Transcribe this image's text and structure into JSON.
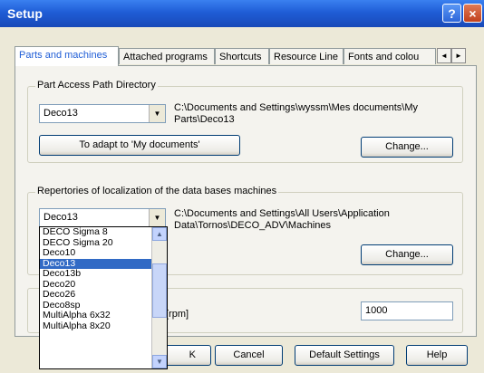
{
  "window": {
    "title": "Setup",
    "help": "?",
    "close": "×"
  },
  "tabs": [
    "Parts and machines",
    "Attached programs",
    "Shortcuts",
    "Resource Line",
    "Fonts and colou"
  ],
  "tab_scroll": {
    "left": "◄",
    "right": "►"
  },
  "part_access": {
    "title": "Part Access Path Directory",
    "combo_value": "Deco13",
    "path": "C:\\Documents and Settings\\wyssm\\Mes documents\\My Parts\\Deco13",
    "adapt_button": "To adapt to 'My documents'",
    "change_button": "Change..."
  },
  "repertories": {
    "title": "Repertories of localization of the data bases machines",
    "combo_value": "Deco13",
    "path": "C:\\Documents and Settings\\All Users\\Application Data\\Tornos\\DECO_ADV\\Machines",
    "change_button": "Change..."
  },
  "dropdown": {
    "items": [
      "DECO Sigma 8",
      "DECO Sigma 20",
      "Deco10",
      "Deco13",
      "Deco13b",
      "Deco20",
      "Deco26",
      "Deco8sp",
      "MultiAlpha 6x32",
      "MultiAlpha 8x20"
    ],
    "selected_index": 3,
    "scroll_up": "▲",
    "scroll_down": "▼"
  },
  "speed": {
    "unit_label": "[rpm]",
    "value": "1000"
  },
  "footer": {
    "ok_fragment": "K",
    "cancel": "Cancel",
    "default_settings": "Default Settings",
    "help": "Help"
  },
  "arrow_glyph": "▼"
}
